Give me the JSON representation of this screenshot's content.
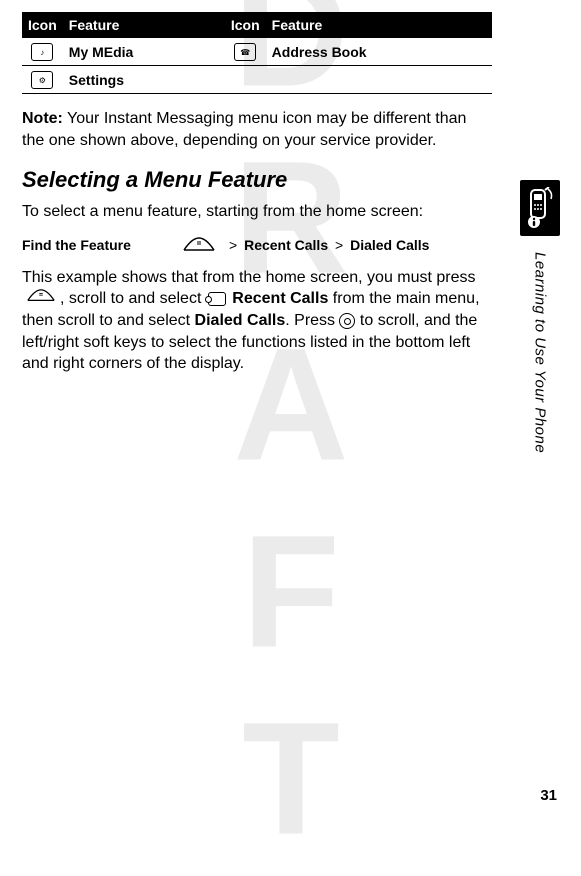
{
  "table": {
    "headers": [
      "Icon",
      "Feature",
      "Icon",
      "Feature"
    ],
    "rows": [
      {
        "icon1": "my-media-icon",
        "feat1": "My MEdia",
        "icon2": "address-book-icon",
        "feat2": "Address Book"
      },
      {
        "icon1": "settings-icon",
        "feat1": "Settings",
        "icon2": "",
        "feat2": ""
      }
    ]
  },
  "note": {
    "label": "Note:",
    "text": " Your Instant Messaging menu icon may be different than the one shown above, depending on your service provider."
  },
  "heading": "Selecting a Menu Feature",
  "intro": "To select a menu feature, starting from the home screen:",
  "find": {
    "label": "Find the Feature",
    "crumb1": "Recent Calls",
    "crumb2": "Dialed Calls"
  },
  "body": {
    "t1": "This example shows that from the home screen, you must press ",
    "t2": ", scroll to and select ",
    "recent": "Recent Calls",
    "t3": " from the main menu, then scroll to and select ",
    "dialed": "Dialed Calls",
    "t4": ". Press ",
    "t5": " to scroll, and the left/right soft keys to select the functions listed in the bottom left and right corners of the display."
  },
  "sideText": "Learning to Use Your Phone",
  "pageNumber": "31",
  "watermark": "DRAFT"
}
